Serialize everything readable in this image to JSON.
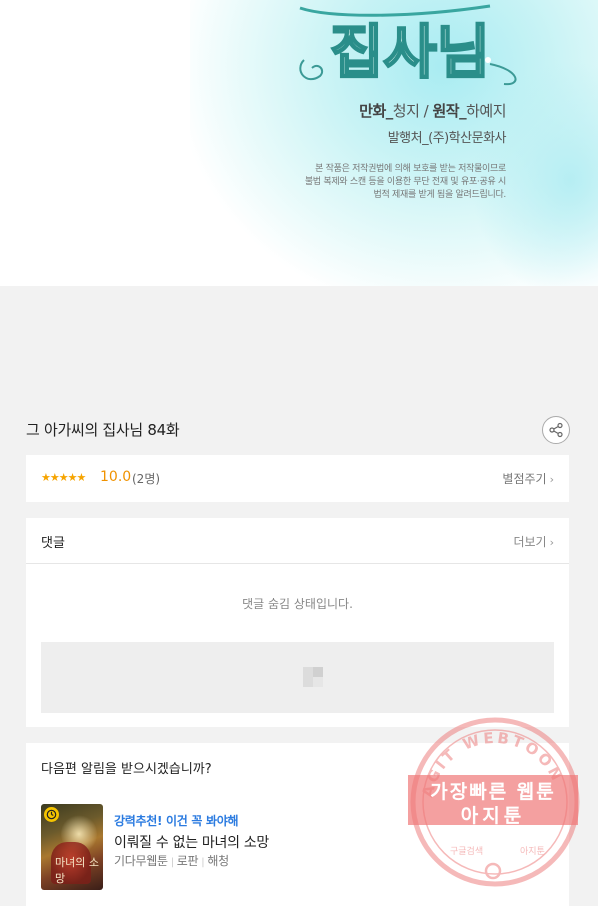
{
  "comic": {
    "logo_text": "집사님",
    "credit_line1_label_art": "만화_",
    "credit_line1_art": "청지",
    "credit_line1_sep": " / ",
    "credit_line1_label_orig": "원작_",
    "credit_line1_orig": "하예지",
    "credit_line2": "발행처_(주)학산문화사",
    "copyright_lines": [
      "본 작품은 저작권법에 의해 보호를 받는 저작물이므로",
      "불법 복제와 스캔 등을 이용한 무단 전재 및 유포·공유 시",
      "법적 제재를 받게 됨을 알려드립니다."
    ]
  },
  "episode": {
    "title": "그 아가씨의 집사님 84화"
  },
  "rating": {
    "stars": "★★★★★",
    "score": "10.0",
    "count": "(2명)",
    "rate_label": "별점주기"
  },
  "comments": {
    "title": "댓글",
    "more_label": "더보기",
    "hidden_message": "댓글 숨김 상태입니다."
  },
  "next_notice": {
    "question": "다음편 알림을 받으시겠습니까?",
    "promo": "강력추천! 이건 꼭 봐야해",
    "rec_title": "이뤄질 수 없는 마녀의 소망",
    "rec_thumb_text": "마녀의 소망",
    "rec_meta": [
      "기다무웹툰",
      "로판",
      "해청"
    ]
  },
  "watermark": {
    "arc_text": "AGIT WEBTOON",
    "line1": "가장빠른 웹툰",
    "line2": "아지툰",
    "bottom_left": "구글검색",
    "bottom_right": "아지툰"
  },
  "colors": {
    "star": "#f6a400",
    "score": "#f09200",
    "promo": "#2b7be0",
    "stamp": "#ee8080"
  },
  "icons": {
    "share": "share-icon",
    "chevron": "chevron-right-icon",
    "clock": "clock-icon",
    "ad": "ad-placeholder-icon"
  }
}
